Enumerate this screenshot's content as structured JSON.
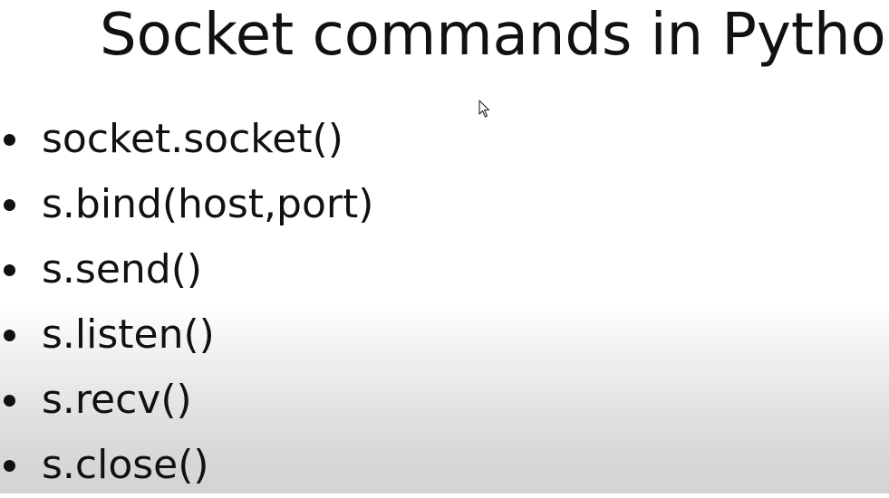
{
  "slide": {
    "title": "Socket commands in Python",
    "bullets": [
      "socket.socket()",
      "s.bind(host,port)",
      "s.send()",
      "s.listen()",
      "s.recv()",
      "s.close()"
    ]
  },
  "colors": {
    "text": "#111111",
    "background_top": "#ffffff",
    "background_bottom": "#d3d3d3"
  },
  "icons": {
    "cursor": "mouse-pointer-icon"
  }
}
